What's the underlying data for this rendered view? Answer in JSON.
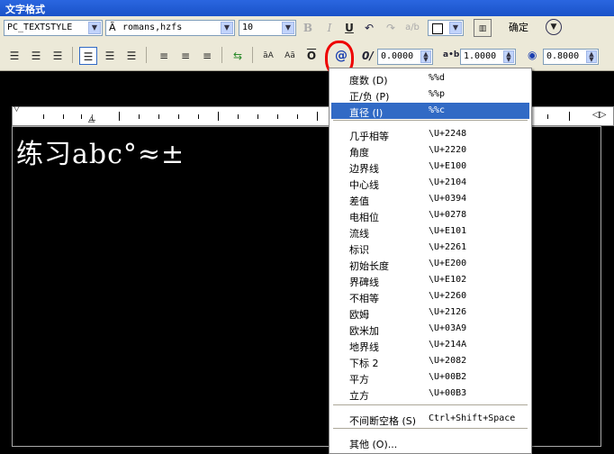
{
  "window": {
    "title": "文字格式"
  },
  "toolbar": {
    "style_combo": "PC_TEXTSTYLE",
    "font_combo": "romans,hzfs",
    "height_combo": "10",
    "bold": "B",
    "italic": "I",
    "underline": "U",
    "ok_label": "确定",
    "oblique_value": "0.0000",
    "tracking_value": "1.0000",
    "width_value": "0.8000",
    "symbol_glyph": "@",
    "tracking_label": "a•b",
    "oblique_label": "0/"
  },
  "editor": {
    "text": "练习abc°≈±"
  },
  "symbol_menu": {
    "items": [
      {
        "name": "度数 (D)",
        "code": "%%d"
      },
      {
        "name": "正/负 (P)",
        "code": "%%p"
      },
      {
        "name": "直径 (I)",
        "code": "%%c",
        "selected": true
      },
      {
        "name": "几乎相等",
        "code": "\\U+2248"
      },
      {
        "name": "角度",
        "code": "\\U+2220"
      },
      {
        "name": "边界线",
        "code": "\\U+E100"
      },
      {
        "name": "中心线",
        "code": "\\U+2104"
      },
      {
        "name": "差值",
        "code": "\\U+0394"
      },
      {
        "name": "电相位",
        "code": "\\U+0278"
      },
      {
        "name": "流线",
        "code": "\\U+E101"
      },
      {
        "name": "标识",
        "code": "\\U+2261"
      },
      {
        "name": "初始长度",
        "code": "\\U+E200"
      },
      {
        "name": "界碑线",
        "code": "\\U+E102"
      },
      {
        "name": "不相等",
        "code": "\\U+2260"
      },
      {
        "name": "欧姆",
        "code": "\\U+2126"
      },
      {
        "name": "欧米加",
        "code": "\\U+03A9"
      },
      {
        "name": "地界线",
        "code": "\\U+214A"
      },
      {
        "name": "下标 2",
        "code": "\\U+2082"
      },
      {
        "name": "平方",
        "code": "\\U+00B2"
      },
      {
        "name": "立方",
        "code": "\\U+00B3"
      },
      {
        "name": "不间断空格 (S)",
        "code": "Ctrl+Shift+Space"
      },
      {
        "name": "其他 (O)...",
        "code": ""
      }
    ]
  },
  "colors": {
    "selection": "#316ac5",
    "annotation_circle": "#e00000"
  }
}
